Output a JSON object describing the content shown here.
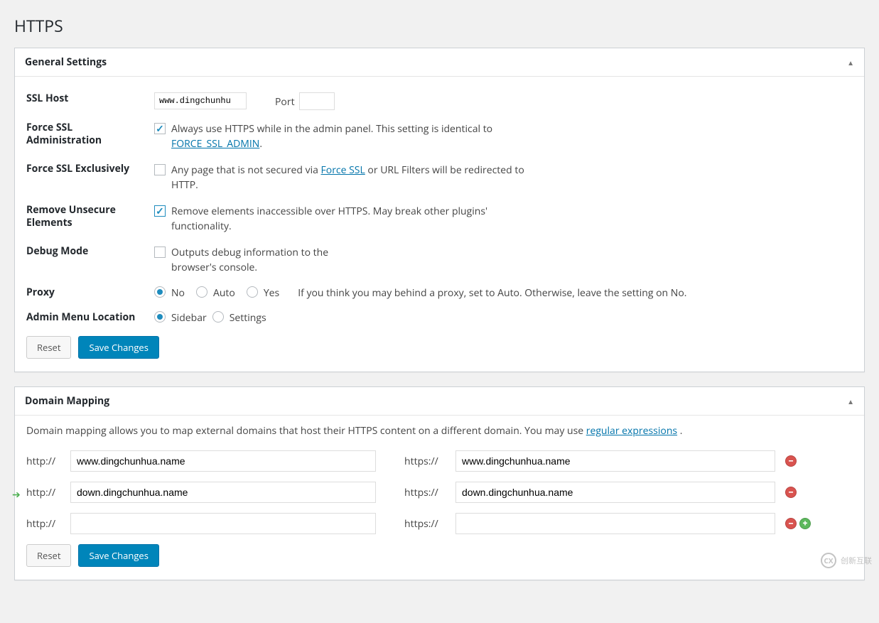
{
  "page": {
    "title": "HTTPS"
  },
  "general": {
    "heading": "General Settings",
    "ssl_host": {
      "label": "SSL Host",
      "value": "www.dingchunhu",
      "port_label": "Port",
      "port_value": ""
    },
    "force_ssl_admin": {
      "label": "Force SSL Administration",
      "desc_pre": "Always use HTTPS while in the admin panel. This setting is identical to ",
      "link": "FORCE_SSL_ADMIN",
      "desc_post": "."
    },
    "force_ssl_exclusively": {
      "label": "Force SSL Exclusively",
      "desc_pre": "Any page that is not secured via ",
      "link": "Force SSL",
      "desc_post": " or URL Filters will be redirected to HTTP."
    },
    "remove_unsecure": {
      "label": "Remove Unsecure Elements",
      "desc": "Remove elements inaccessible over HTTPS. May break other plugins' functionality."
    },
    "debug_mode": {
      "label": "Debug Mode",
      "desc": "Outputs debug information to the browser's console."
    },
    "proxy": {
      "label": "Proxy",
      "options": {
        "no": "No",
        "auto": "Auto",
        "yes": "Yes"
      },
      "hint": "If you think you may behind a proxy, set to Auto. Otherwise, leave the setting on No."
    },
    "admin_menu": {
      "label": "Admin Menu Location",
      "options": {
        "sidebar": "Sidebar",
        "settings": "Settings"
      }
    },
    "buttons": {
      "reset": "Reset",
      "save": "Save Changes"
    }
  },
  "domain_mapping": {
    "heading": "Domain Mapping",
    "desc_pre": "Domain mapping allows you to map external domains that host their HTTPS content on a different domain. You may use ",
    "link": "regular expressions",
    "desc_post": " .",
    "http_label": "http://",
    "https_label": "https://",
    "rows": [
      {
        "http": "www.dingchunhua.name",
        "https": "www.dingchunhua.name",
        "removable": true,
        "addable": false
      },
      {
        "http": "down.dingchunhua.name",
        "https": "down.dingchunhua.name",
        "removable": true,
        "addable": false
      },
      {
        "http": "",
        "https": "",
        "removable": true,
        "addable": true
      }
    ],
    "buttons": {
      "reset": "Reset",
      "save": "Save Changes"
    }
  },
  "watermark": {
    "text": "创新互联"
  }
}
